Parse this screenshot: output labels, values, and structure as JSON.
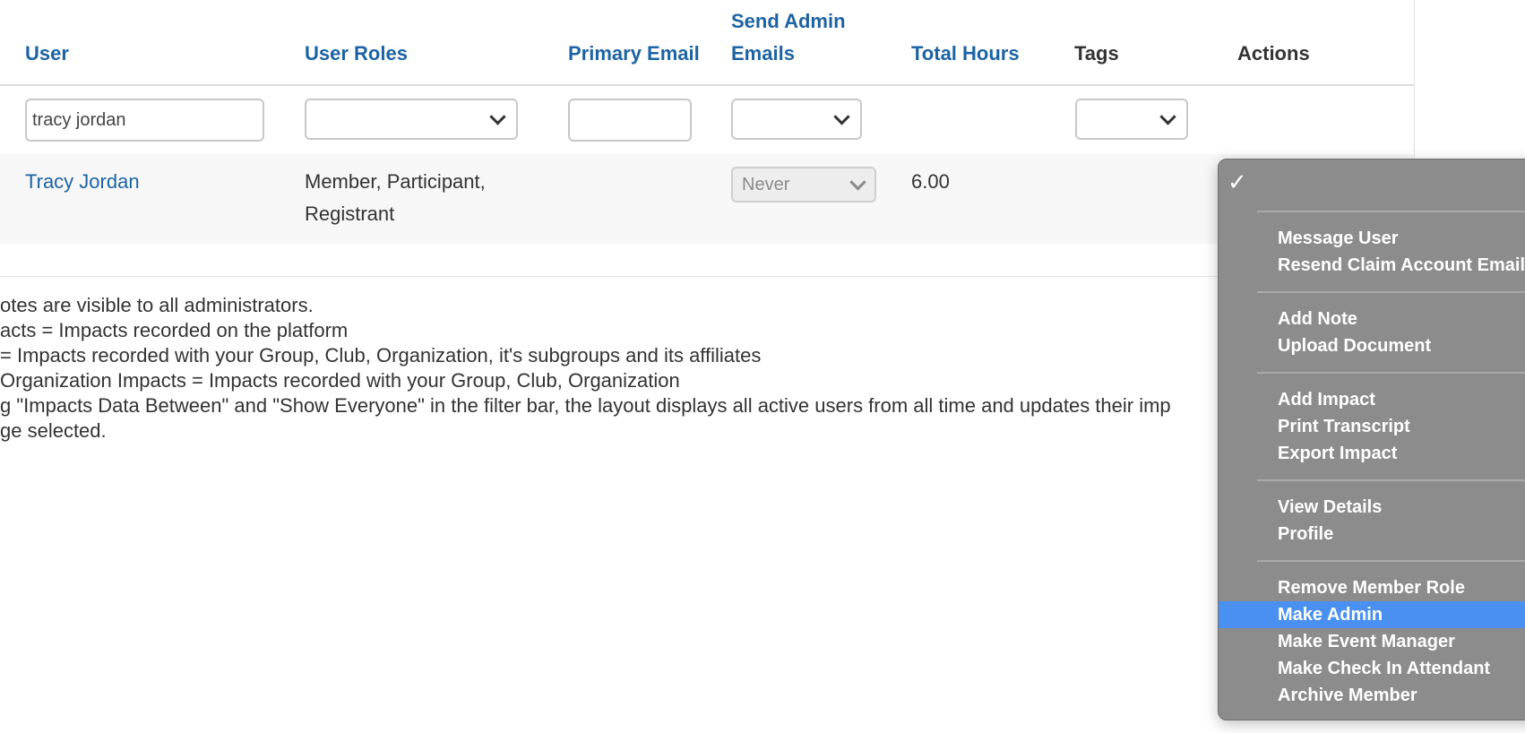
{
  "columns": {
    "user": "User",
    "user_roles": "User Roles",
    "primary_email": "Primary Email",
    "send_admin_emails_1": "Send Admin",
    "send_admin_emails_2": "Emails",
    "total_hours": "Total Hours",
    "tags": "Tags",
    "actions": "Actions"
  },
  "filters": {
    "user_value": "tracy jordan",
    "user_roles_value": "",
    "primary_email_value": "",
    "send_admin_emails_value": "",
    "tags_value": ""
  },
  "row": {
    "user": "Tracy Jordan",
    "roles_line1": "Member, Participant,",
    "roles_line2": "Registrant",
    "send_admin_emails": "Never",
    "total_hours": "6.00"
  },
  "notes": [
    "otes are visible to all administrators.",
    "acts = Impacts recorded on the platform",
    "= Impacts recorded with your Group, Club, Organization, it's subgroups and its affiliates",
    "Organization Impacts = Impacts recorded with your Group, Club, Organization",
    "g \"Impacts Data Between\" and \"Show Everyone\" in the filter bar, the layout displays all active users from all time and updates their imp",
    "ge selected."
  ],
  "menu": {
    "check": "✓",
    "groups": [
      [
        "Message User",
        "Resend Claim Account Email"
      ],
      [
        "Add Note",
        "Upload Document"
      ],
      [
        "Add Impact",
        "Print Transcript",
        "Export Impact"
      ],
      [
        "View Details",
        "Profile"
      ],
      [
        "Remove Member Role",
        "Make Admin",
        "Make Event Manager",
        "Make Check In Attendant",
        "Archive Member"
      ]
    ],
    "highlighted": "Make Admin"
  },
  "colors": {
    "link": "#1d63a3",
    "menu_bg": "#8c8c8c",
    "menu_highlight": "#4a90f0"
  }
}
